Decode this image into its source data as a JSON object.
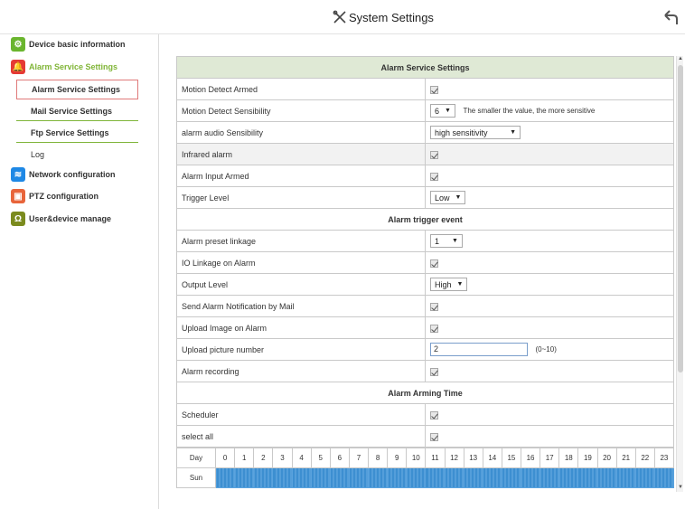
{
  "header": {
    "title": "System Settings"
  },
  "sidebar": {
    "items": [
      {
        "label": "Device basic information",
        "color": "#6ab52e",
        "icon": "gear-icon"
      },
      {
        "label": "Alarm Service Settings",
        "color": "#e53935",
        "icon": "bell-icon"
      },
      {
        "label": "Network configuration",
        "color": "#1e88e5",
        "icon": "wifi-icon"
      },
      {
        "label": "PTZ configuration",
        "color": "#e8643a",
        "icon": "camera-icon"
      },
      {
        "label": "User&device manage",
        "color": "#7b8b1e",
        "icon": "user-icon"
      }
    ],
    "sub_items": [
      {
        "label": "Alarm Service Settings"
      },
      {
        "label": "Mail Service Settings"
      },
      {
        "label": "Ftp Service Settings"
      },
      {
        "label": "Log"
      }
    ]
  },
  "panel": {
    "title": "Alarm Service Settings",
    "rows": {
      "motion_armed": "Motion Detect Armed",
      "motion_sens": "Motion Detect Sensibility",
      "motion_sens_value": "6",
      "motion_sens_hint": "The smaller the value, the more sensitive",
      "audio_sens": "alarm audio Sensibility",
      "audio_sens_value": "high sensitivity",
      "infrared": "Infrared alarm",
      "input_armed": "Alarm Input Armed",
      "trigger_level": "Trigger Level",
      "trigger_level_value": "Low"
    },
    "trigger_event": {
      "title": "Alarm trigger event",
      "preset": "Alarm preset linkage",
      "preset_value": "1",
      "io_linkage": "IO Linkage on Alarm",
      "output_level": "Output Level",
      "output_level_value": "High",
      "send_mail": "Send Alarm Notification by Mail",
      "upload_image": "Upload Image on Alarm",
      "upload_number": "Upload picture number",
      "upload_number_value": "2",
      "upload_number_hint": "(0~10)",
      "recording": "Alarm recording"
    },
    "arming": {
      "title": "Alarm Arming Time",
      "scheduler": "Scheduler",
      "select_all": "select all",
      "day_header": "Day",
      "hours": [
        "0",
        "1",
        "2",
        "3",
        "4",
        "5",
        "6",
        "7",
        "8",
        "9",
        "10",
        "11",
        "12",
        "13",
        "14",
        "15",
        "16",
        "17",
        "18",
        "19",
        "20",
        "21",
        "22",
        "23"
      ],
      "days": [
        "Sun"
      ],
      "schedule_color": "#3d8fd1"
    }
  }
}
